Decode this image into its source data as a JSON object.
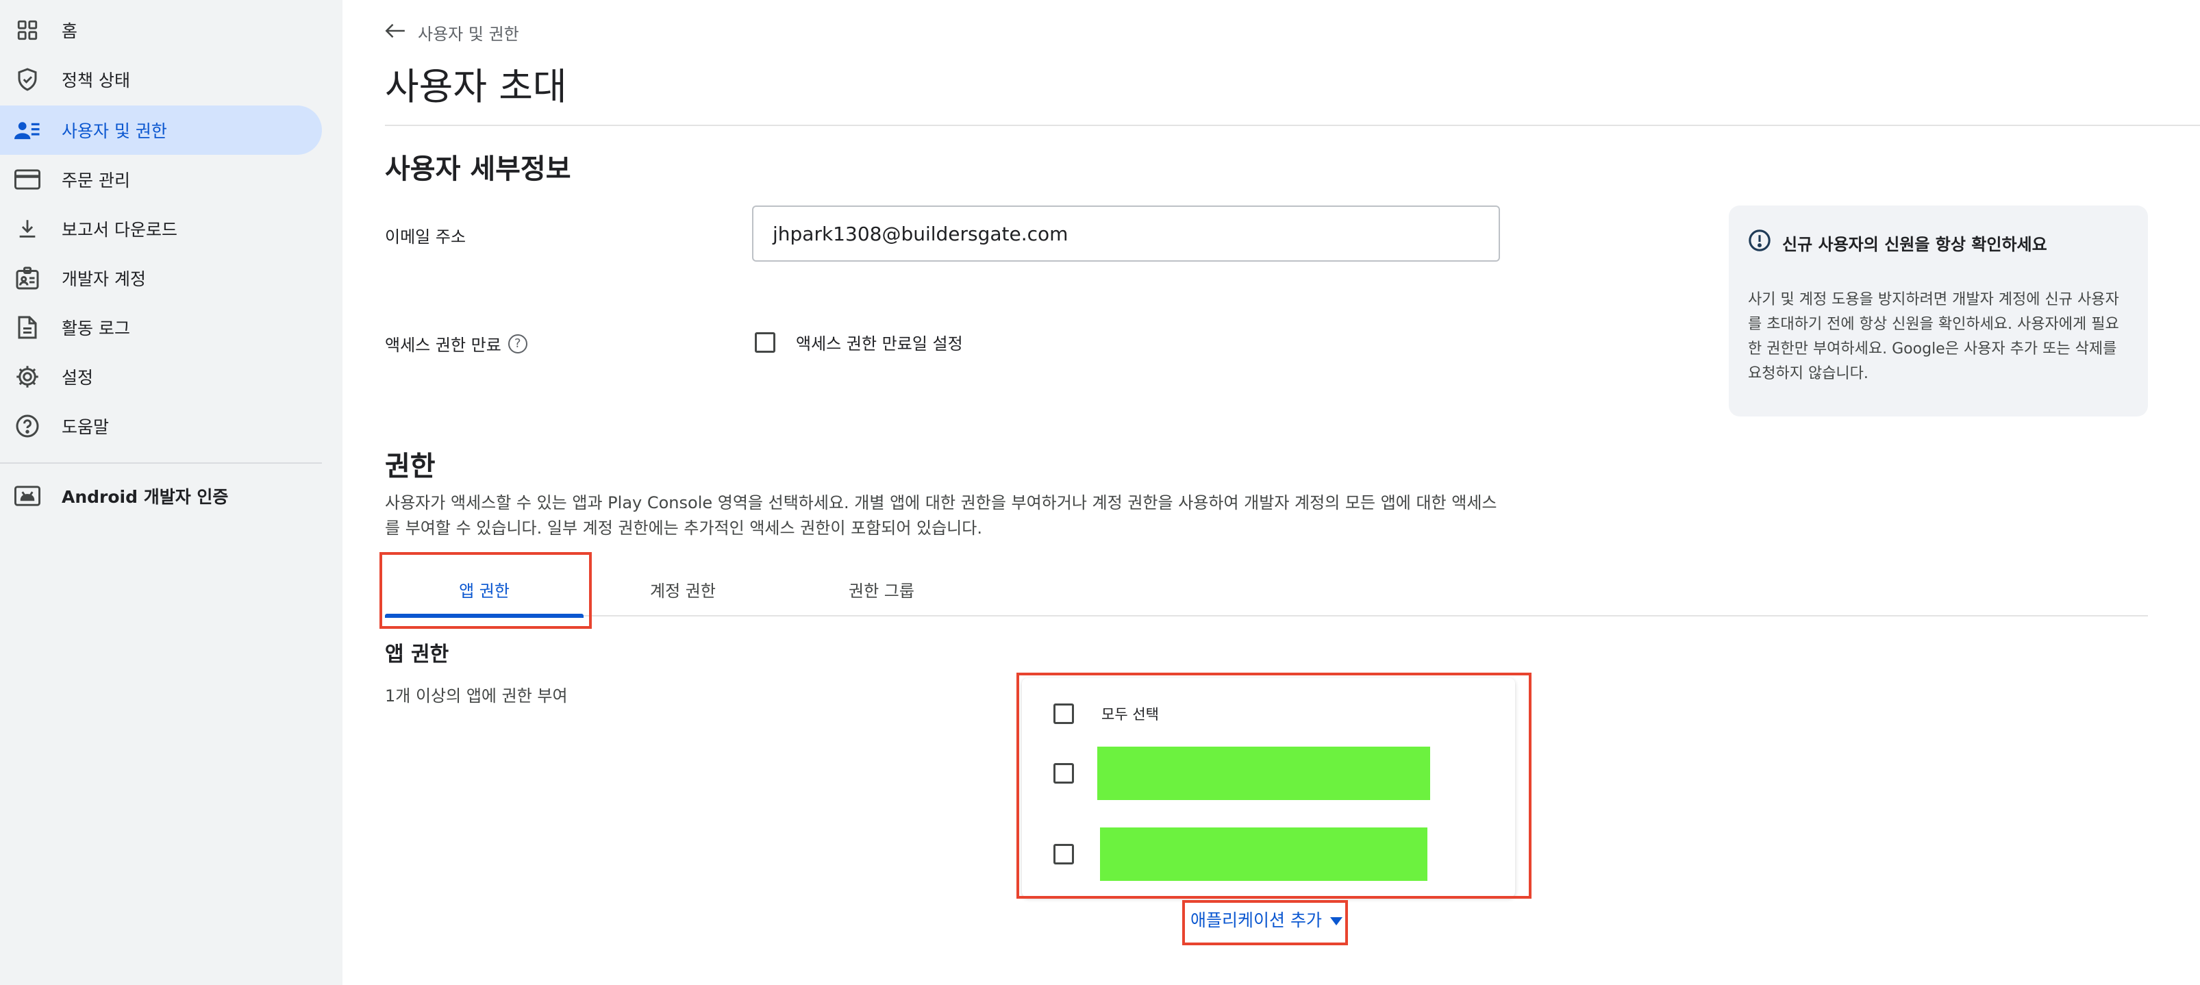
{
  "sidebar": {
    "items": [
      {
        "label": "홈",
        "icon": "dashboard-grid-icon"
      },
      {
        "label": "정책 상태",
        "icon": "shield-check-icon"
      },
      {
        "label": "사용자 및 권한",
        "icon": "user-list-icon",
        "active": true
      },
      {
        "label": "주문 관리",
        "icon": "credit-card-icon"
      },
      {
        "label": "보고서 다운로드",
        "icon": "download-icon"
      },
      {
        "label": "개발자 계정",
        "icon": "id-badge-icon"
      },
      {
        "label": "활동 로그",
        "icon": "document-icon"
      },
      {
        "label": "설정",
        "icon": "gear-icon"
      },
      {
        "label": "도움말",
        "icon": "help-icon"
      }
    ],
    "android": {
      "label": "Android 개발자 인증",
      "icon": "android-verify-icon"
    }
  },
  "header": {
    "breadcrumb": "사용자 및 권한",
    "title": "사용자 초대"
  },
  "details": {
    "title": "사용자 세부정보",
    "email_label": "이메일 주소",
    "email_value": "jhpark1308@buildersgate.com",
    "expiry_label": "액세스 권한 만료",
    "expiry_help": "?",
    "expiry_checkbox_label": "액세스 권한 만료일 설정"
  },
  "info_card": {
    "title": "신규 사용자의 신원을 항상 확인하세요",
    "body": "사기 및 계정 도용을 방지하려면 개발자 계정에 신규 사용자를 초대하기 전에 항상 신원을 확인하세요. 사용자에게 필요한 권한만 부여하세요. Google은 사용자 추가 또는 삭제를 요청하지 않습니다."
  },
  "permissions": {
    "title": "권한",
    "description": "사용자가 액세스할 수 있는 앱과 Play Console 영역을 선택하세요. 개별 앱에 대한 권한을 부여하거나 계정 권한을 사용하여 개발자 계정의 모든 앱에 대한 액세스를 부여할 수 있습니다. 일부 계정 권한에는 추가적인 액세스 권한이 포함되어 있습니다.",
    "tabs": [
      {
        "label": "앱 권한",
        "active": true
      },
      {
        "label": "계정 권한"
      },
      {
        "label": "권한 그룹"
      }
    ],
    "app_section_title": "앱 권한",
    "app_section_desc": "1개 이상의 앱에 권한 부여",
    "select_all_label": "모두 선택",
    "add_app_label": "애플리케이션 추가"
  },
  "colors": {
    "accent": "#0b57d0",
    "active_nav_bg": "#d3e3fd",
    "highlight_red": "#e8442f",
    "redacted_green": "#6cf23f"
  }
}
